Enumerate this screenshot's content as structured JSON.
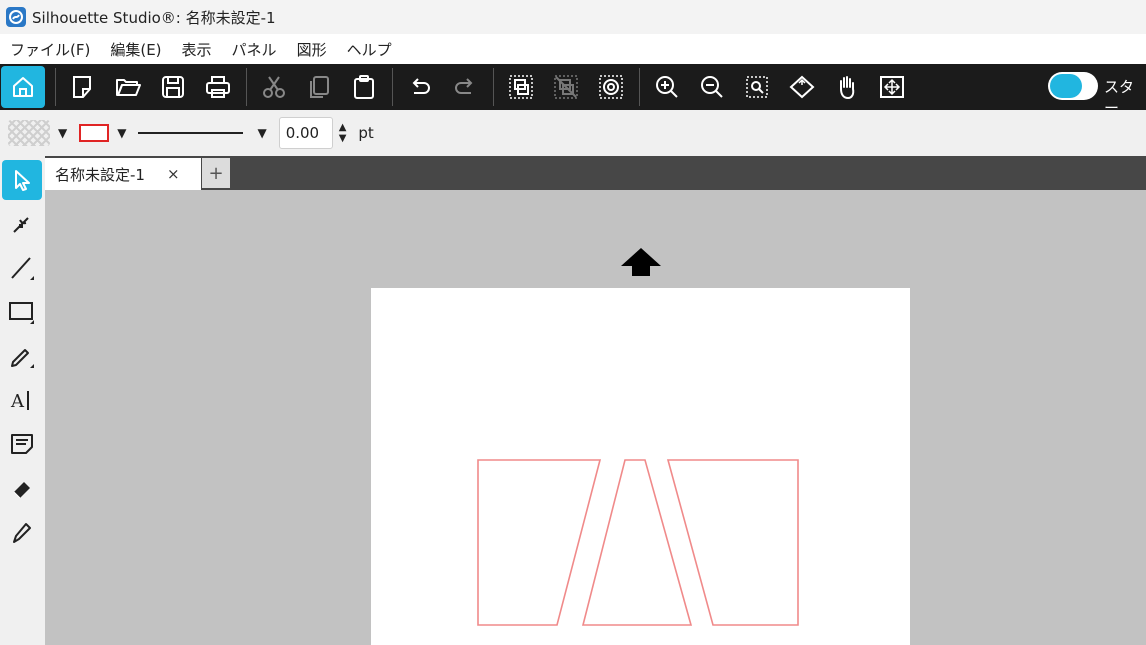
{
  "window": {
    "title": "Silhouette Studio®: 名称未設定-1"
  },
  "menu": {
    "items": [
      "ファイル(F)",
      "編集(E)",
      "表示",
      "パネル",
      "図形",
      "ヘルプ"
    ]
  },
  "toolbar": {
    "buttons": [
      "home-icon",
      "new-document-icon",
      "open-folder-icon",
      "save-icon",
      "print-icon",
      "cut-icon",
      "copy-icon",
      "paste-icon",
      "undo-icon",
      "redo-icon",
      "group-icon",
      "ungroup-icon",
      "release-compound-icon",
      "zoom-in-icon",
      "zoom-out-icon",
      "zoom-selection-icon",
      "fit-page-icon",
      "pan-hand-icon",
      "fit-window-icon"
    ],
    "start_label": "スター",
    "accent": "#21b6e0"
  },
  "properties": {
    "line_width_value": "0.00",
    "unit": "pt",
    "stroke_color": "#e02424"
  },
  "left_tools": [
    "select-tool-icon",
    "point-edit-tool-icon",
    "line-tool-icon",
    "rectangle-tool-icon",
    "pencil-tool-icon",
    "text-tool-icon",
    "notes-tool-icon",
    "eraser-tool-icon",
    "knife-tool-icon"
  ],
  "tabs": {
    "active_label": "名称未設定-1",
    "close_glyph": "×",
    "add_glyph": "+"
  },
  "canvas": {
    "shape_stroke": "#f08a8a"
  }
}
